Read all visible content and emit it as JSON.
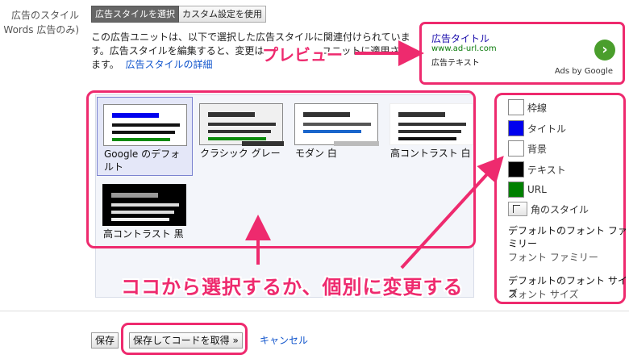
{
  "side_label": {
    "line1": "広告のスタイル",
    "line2": "Words 広告のみ)"
  },
  "tabs": [
    {
      "label": "広告スタイルを選択",
      "active": true
    },
    {
      "label": "カスタム設定を使用",
      "active": false
    }
  ],
  "description": {
    "line1": "この広告ユニットは、以下で選択した広告スタイルに関連付けられていま",
    "line2": "す。広告スタイルを編集すると、変更は",
    "line2_tail": "ユニットに適用さ",
    "line3_start": "ます。",
    "link": "広告スタイルの詳細"
  },
  "preview": {
    "title": "広告タイトル",
    "url": "www.ad-url.com",
    "text": "広告テキスト",
    "ads_by": "Ads by Google"
  },
  "callouts": {
    "preview": "プレビュー",
    "main": "ココから選択するか、個別に変更する"
  },
  "styles": [
    {
      "label": "Google のデフォルト",
      "selected": true
    },
    {
      "label": "クラシック グレー",
      "selected": false
    },
    {
      "label": "モダン 白",
      "selected": false
    },
    {
      "label": "高コントラスト 白",
      "selected": false
    },
    {
      "label": "高コントラスト 黒",
      "selected": false
    }
  ],
  "options": {
    "border": {
      "label": "枠線",
      "color": "#ffffff"
    },
    "title": {
      "label": "タイトル",
      "color": "#0000ee"
    },
    "background": {
      "label": "背景",
      "color": "#ffffff"
    },
    "text": {
      "label": "テキスト",
      "color": "#000000"
    },
    "url": {
      "label": "URL",
      "color": "#008000"
    },
    "corner": {
      "label": "角のスタイル"
    },
    "font_family": {
      "heading": "デフォルトのフォント ファミリー",
      "value": "フォント ファミリー"
    },
    "font_size": {
      "heading": "デフォルトのフォント サイズ",
      "value": "フォント サイズ"
    }
  },
  "buttons": {
    "save": "保存",
    "save_get_code": "保存してコードを取得 »",
    "cancel": "キャンセル"
  },
  "accent_color": "#ee2a6e"
}
